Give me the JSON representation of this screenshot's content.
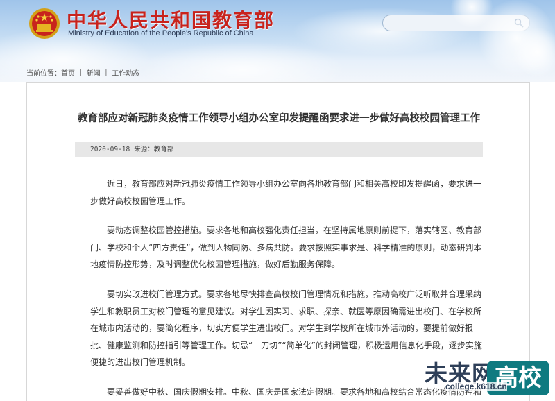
{
  "header": {
    "title": "中华人民共和国教育部",
    "subtitle": "Ministry of Education of the People's Republic of China",
    "search_placeholder": "",
    "colors": {
      "title": "#c8231d",
      "sky": "#9fc4ea"
    }
  },
  "breadcrumb": {
    "prefix": "当前位置：",
    "items": [
      "首页",
      "新闻",
      "工作动态"
    ],
    "separator": "|"
  },
  "article": {
    "title": "教育部应对新冠肺炎疫情工作领导小组办公室印发提醒函要求进一步做好高校校园管理工作",
    "date": "2020-09-18",
    "source_label": "来源：",
    "source": "教育部",
    "paragraphs": [
      "近日，教育部应对新冠肺炎疫情工作领导小组办公室向各地教育部门和相关高校印发提醒函，要求进一步做好高校校园管理工作。",
      "要动态调整校园管控措施。要求各地和高校强化责任担当，在坚持属地原则前提下，落实辖区、教育部门、学校和个人“四方责任”，做到人物同防、多病共防。要求按照实事求是、科学精准的原则，动态研判本地疫情防控形势，及时调整优化校园管理措施，做好后勤服务保障。",
      "要切实改进校门管理方式。要求各地尽快排查高校校门管理情况和措施，推动高校广泛听取并合理采纳学生和教职员工对校门管理的意见建议。对学生因实习、求职、探亲、就医等原因确需进出校门、在学校所在城市内活动的，要简化程序，切实方便学生进出校门。对学生到学校所在城市外活动的，要提前做好报批、健康监测和防控指引等管理工作。切忌“一刀切”“简单化”的封闭管理，积极运用信息化手段，逐步实施便捷的进出校门管理机制。",
      "要妥善做好中秋、国庆假期安排。中秋、国庆是国家法定假期。要求各地和高校结合常态化疫情防控和教学进"
    ]
  },
  "watermark": {
    "brand": "未来网",
    "badge": "高校",
    "url": "college.k618.cn"
  }
}
